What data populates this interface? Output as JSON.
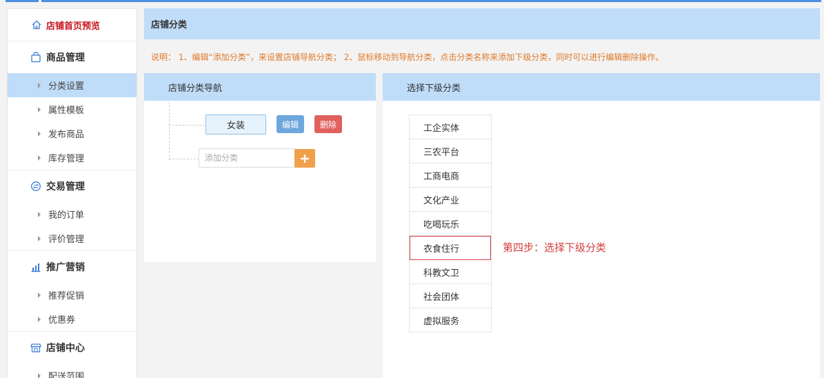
{
  "colors": {
    "accent_blue": "#bfdcf8",
    "brand_red": "#c9151e",
    "note_orange": "#e07a2a",
    "edit_blue": "#6ea6de",
    "delete_red": "#e0605e",
    "add_orange": "#f0a04b",
    "highlight_red": "#d43c3c"
  },
  "sidebar": {
    "home_label": "店铺首页预览",
    "groups": [
      {
        "label": "商品管理",
        "icon": "shopping-bag-icon",
        "items": [
          "分类设置",
          "属性模板",
          "发布商品",
          "库存管理"
        ]
      },
      {
        "label": "交易管理",
        "icon": "exchange-icon",
        "items": [
          "我的订单",
          "评价管理"
        ]
      },
      {
        "label": "推广营销",
        "icon": "bar-chart-icon",
        "items": [
          "推荐促销",
          "优惠券"
        ]
      },
      {
        "label": "店铺中心",
        "icon": "store-icon",
        "items": [
          "配送范围"
        ]
      }
    ]
  },
  "main": {
    "title": "店铺分类",
    "note": "说明： 1、编辑“添加分类”，来设置店铺导航分类； 2、鼠标移动到导航分类，点击分类名称来添加下级分类，同时可以进行编辑删除操作。"
  },
  "nav_panel": {
    "title": "店铺分类导航",
    "category": "女装",
    "edit_label": "编辑",
    "delete_label": "删除",
    "add_placeholder": "添加分类",
    "add_icon": "plus-icon"
  },
  "sub_panel": {
    "title": "选择下级分类",
    "items": [
      "工企实体",
      "三农平台",
      "工商电商",
      "文化产业",
      "吃喝玩乐",
      "衣食住行",
      "科教文卫",
      "社会团体",
      "虚拟服务"
    ],
    "highlighted": "衣食住行",
    "step_note": "第四步：选择下级分类"
  }
}
